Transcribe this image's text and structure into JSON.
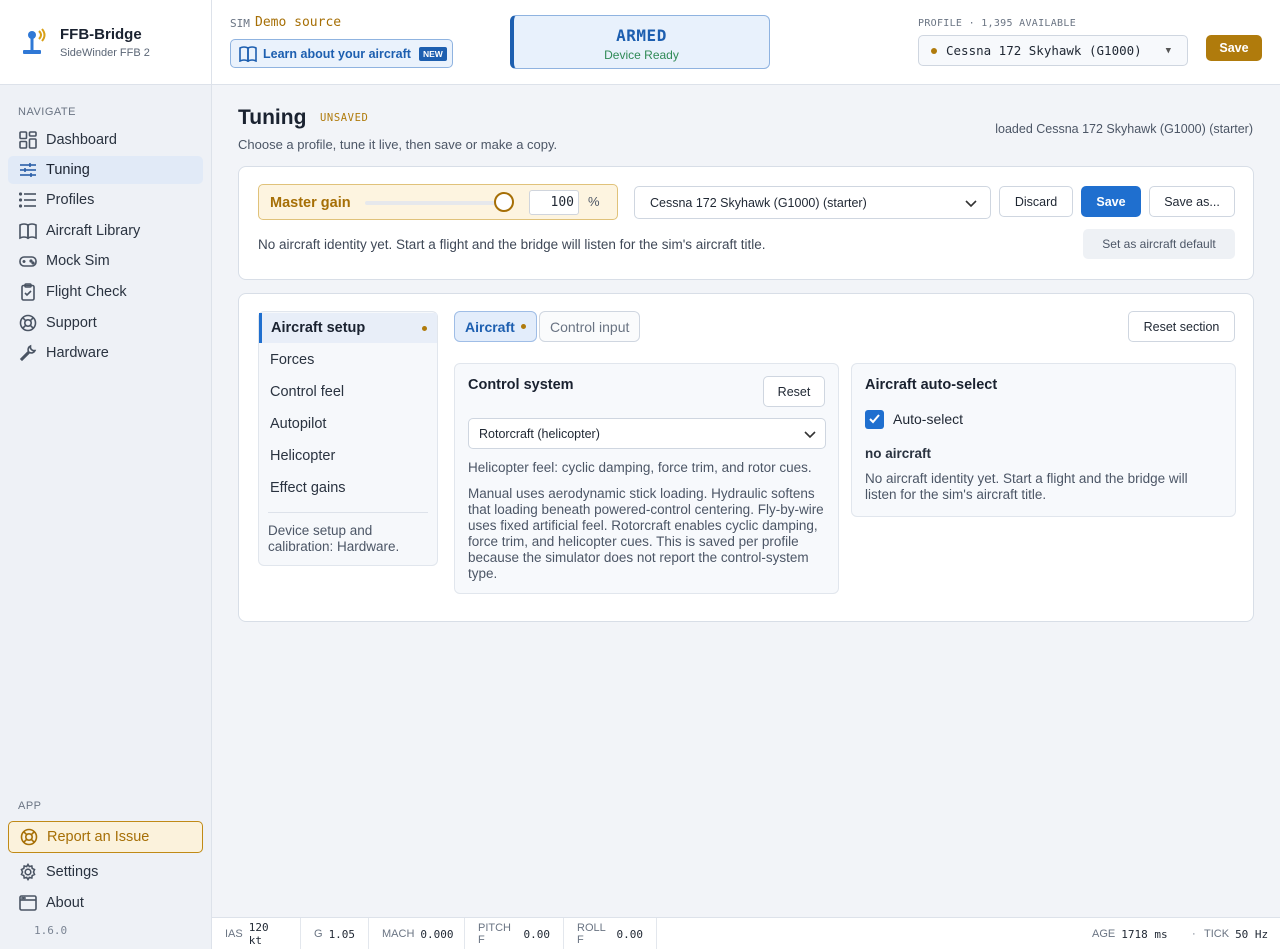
{
  "app": {
    "name": "FFB-Bridge",
    "device": "SideWinder FFB 2",
    "version": "1.6.0"
  },
  "sidebar": {
    "navigate_label": "NAVIGATE",
    "items": [
      {
        "label": "Dashboard",
        "icon": "dashboard-icon"
      },
      {
        "label": "Tuning",
        "icon": "sliders-icon"
      },
      {
        "label": "Profiles",
        "icon": "list-icon"
      },
      {
        "label": "Aircraft Library",
        "icon": "book-icon"
      },
      {
        "label": "Mock Sim",
        "icon": "gamepad-icon"
      },
      {
        "label": "Flight Check",
        "icon": "clipboard-icon"
      },
      {
        "label": "Support",
        "icon": "lifebuoy-icon"
      },
      {
        "label": "Hardware",
        "icon": "wrench-icon"
      }
    ],
    "app_label": "APP",
    "report": "Report an Issue",
    "settings": "Settings",
    "about": "About"
  },
  "topbar": {
    "sim_label": "SIM",
    "sim_value": "Demo source",
    "learn": "Learn about your aircraft",
    "learn_badge": "NEW",
    "armed_title": "ARMED",
    "armed_sub": "Device Ready",
    "profile_label": "PROFILE · 1,395 AVAILABLE",
    "profile_value": "Cessna 172 Skyhawk (G1000)",
    "save": "Save"
  },
  "page": {
    "title": "Tuning",
    "status": "UNSAVED",
    "subtitle": "Choose a profile, tune it live, then save or make a copy.",
    "loaded": "loaded Cessna 172 Skyhawk (G1000) (starter)"
  },
  "gain": {
    "label": "Master gain",
    "value": "100",
    "unit": "%",
    "slider_fraction": 1.0
  },
  "profile_select": "Cessna 172 Skyhawk (G1000) (starter)",
  "buttons": {
    "discard": "Discard",
    "save": "Save",
    "save_as": "Save as...",
    "set_default": "Set as aircraft default",
    "reset_section": "Reset section",
    "reset": "Reset"
  },
  "identity_note": "No aircraft identity yet. Start a flight and the bridge will listen for the sim's aircraft title.",
  "subnav": {
    "items": [
      "Aircraft setup",
      "Forces",
      "Control feel",
      "Autopilot",
      "Helicopter",
      "Effect gains"
    ],
    "note": "Device setup and calibration: Hardware."
  },
  "tabs": {
    "aircraft": "Aircraft",
    "control_input": "Control input"
  },
  "control_system": {
    "title": "Control system",
    "value": "Rotorcraft (helicopter)",
    "hint": "Helicopter feel: cyclic damping, force trim, and rotor cues.",
    "description": "Manual uses aerodynamic stick loading. Hydraulic softens that loading beneath powered-control centering. Fly-by-wire uses fixed artificial feel. Rotorcraft enables cyclic damping, force trim, and helicopter cues. This is saved per profile because the simulator does not report the control-system type."
  },
  "auto_select": {
    "title": "Aircraft auto-select",
    "checkbox": "Auto-select",
    "checked": true,
    "state": "no aircraft",
    "note": "No aircraft identity yet. Start a flight and the bridge will listen for the sim's aircraft title."
  },
  "status": {
    "ias_label": "IAS",
    "ias": "120 kt",
    "g_label": "G",
    "g": "1.05",
    "mach_label": "MACH",
    "mach": "0.000",
    "pitch_label": "PITCH F",
    "pitch": "0.00",
    "roll_label": "ROLL F",
    "roll": "0.00",
    "age_label": "AGE",
    "age": "1718 ms",
    "sep": "·",
    "tick_label": "TICK",
    "tick": "50 Hz"
  },
  "colors": {
    "accent": "#1f6fcf",
    "warning": "#b07b0c",
    "ready": "#2f8a56"
  }
}
